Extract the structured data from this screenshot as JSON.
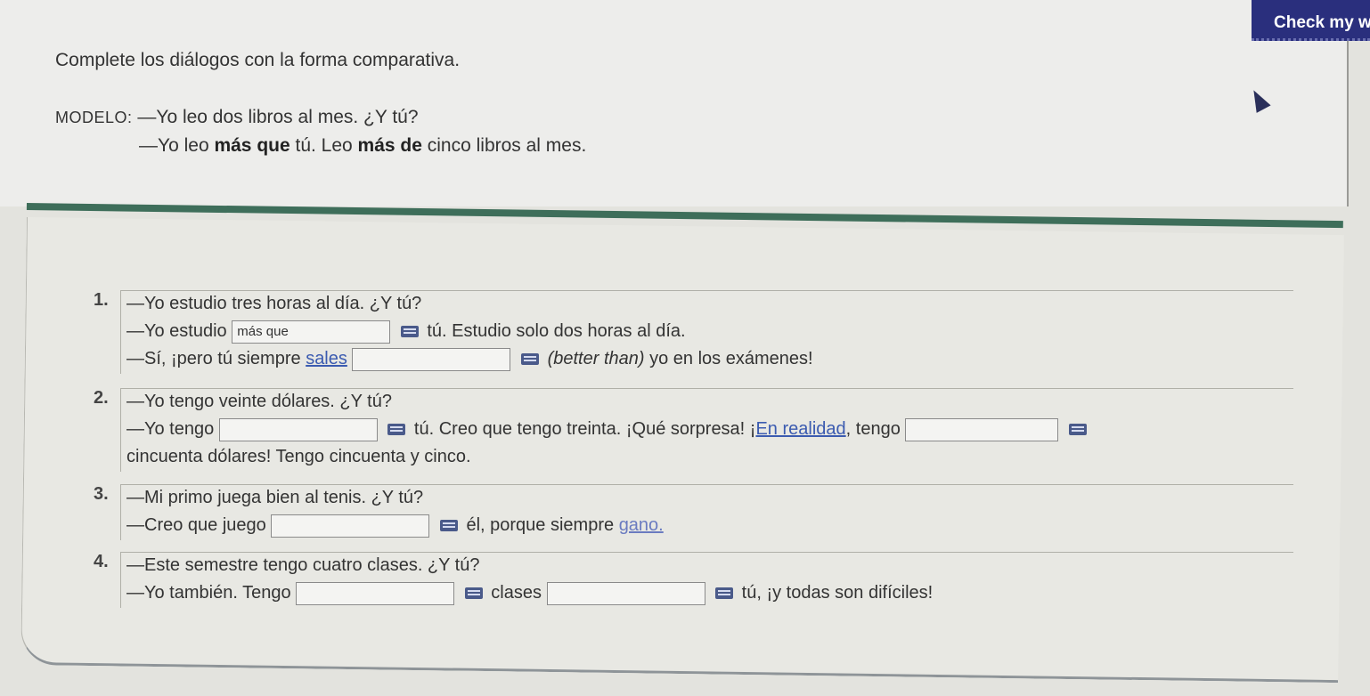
{
  "header": {
    "check_button_label": "Check my w",
    "instructions": "Complete los diálogos con la forma comparativa.",
    "model_label": "MODELO:",
    "model_line1": "—Yo leo dos libros al mes. ¿Y tú?",
    "model_line2_pre": "—Yo leo ",
    "model_line2_bold1": "más que",
    "model_line2_mid": " tú. Leo ",
    "model_line2_bold2": "más de",
    "model_line2_post": " cinco libros al mes."
  },
  "items": [
    {
      "number": "1.",
      "l1": "—Yo estudio tres horas al día. ¿Y tú?",
      "l2_pre": "—Yo estudio",
      "l2_blank": "más que",
      "l2_post": "tú. Estudio solo dos horas al día.",
      "l3_pre": "—Sí, ¡pero tú siempre",
      "l3_link": "sales",
      "l3_blank": "",
      "l3_post_italic": "(better than)",
      "l3_post": " yo en los exámenes!"
    },
    {
      "number": "2.",
      "l1": "—Yo tengo veinte dólares. ¿Y tú?",
      "l2_pre": "—Yo tengo",
      "l2_blank": "",
      "l2_mid": "tú. Creo que tengo treinta. ¡Qué sorpresa! ¡",
      "l2_link": "En realidad",
      "l2_post": ", tengo",
      "l2_blank2": "",
      "l3": "cincuenta dólares! Tengo cincuenta y cinco."
    },
    {
      "number": "3.",
      "l1": "—Mi primo juega bien al tenis. ¿Y tú?",
      "l2_pre": "—Creo que juego",
      "l2_blank": "",
      "l2_mid": "él, porque siempre",
      "l2_link": "gano."
    },
    {
      "number": "4.",
      "l1": "—Este semestre tengo cuatro clases. ¿Y tú?",
      "l2_pre": "—Yo también. Tengo",
      "l2_blank": "",
      "l2_mid": "clases",
      "l2_blank2": "",
      "l2_post": "tú, ¡y todas son difíciles!"
    }
  ]
}
